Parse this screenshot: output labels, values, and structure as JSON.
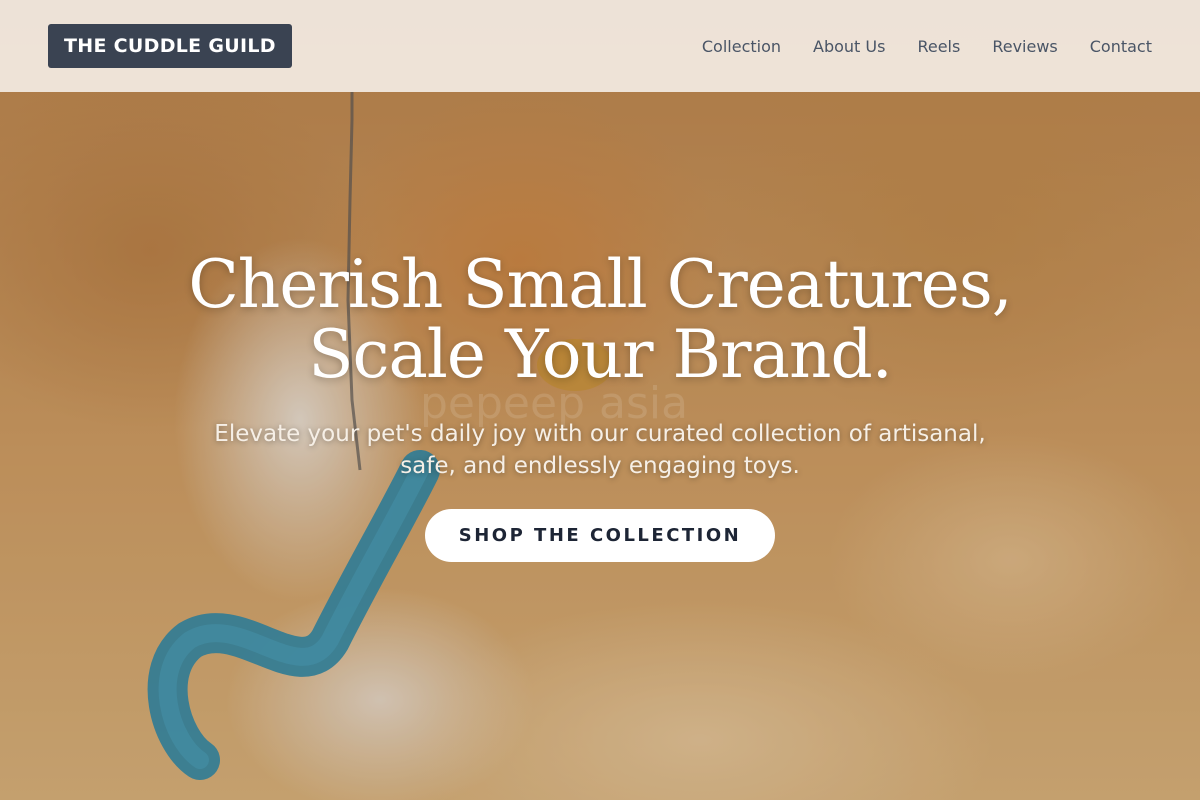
{
  "header": {
    "logo_text": "THE CUDDLE GUILD",
    "nav": [
      {
        "label": "Collection"
      },
      {
        "label": "About Us"
      },
      {
        "label": "Reels"
      },
      {
        "label": "Reviews"
      },
      {
        "label": "Contact"
      }
    ]
  },
  "hero": {
    "headline_line1": "Cherish Small Creatures,",
    "headline_line2": "Scale Your Brand.",
    "subheadline": "Elevate your pet's daily joy with our curated collection of artisanal, safe, and endlessly engaging toys.",
    "cta_label": "SHOP THE COLLECTION",
    "watermark_text": "pepeep asia",
    "image": "orange-and-white cat holding a blue fuzzy toy"
  },
  "colors": {
    "header_bg": "#f3ece4",
    "logo_bg": "#3a4352",
    "nav_text": "#4a5566",
    "cta_bg": "#ffffff",
    "cta_text": "#1d2535"
  }
}
